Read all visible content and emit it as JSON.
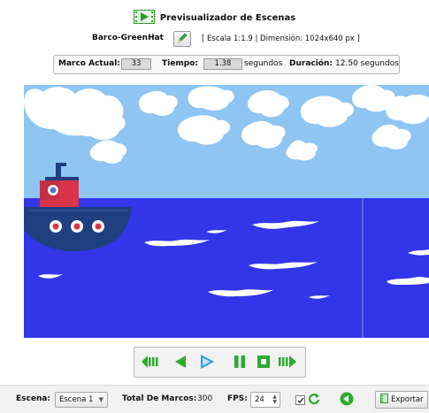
{
  "header": {
    "title": "Previsualizador de Escenas",
    "asset_name": "Barco-GreenHat",
    "scale_info": "[ Escala 1:1.9 | Dimensión: 1024x640 px ]"
  },
  "info": {
    "frame_label": "Marco Actual:",
    "frame_value": "33",
    "time_label": "Tiempo:",
    "time_value": "1.38",
    "time_unit": "segundos",
    "duration_label": "Duración:",
    "duration_value": "12.50 segundos"
  },
  "scene_colors": {
    "sky": "#8ec5f2",
    "sea": "#3236e8",
    "boat_hull": "#1f3f80",
    "cabin": "#d9344a"
  },
  "controls": {
    "icons": [
      "first-frame-icon",
      "step-back-icon",
      "play-icon",
      "pause-icon",
      "stop-icon",
      "last-frame-icon"
    ],
    "accent": "#2eaa2e",
    "play_color": "#2b9cd8"
  },
  "bottom": {
    "scene_label": "Escena:",
    "scene_value": "Escena 1",
    "total_frames_label": "Total De Marcos:",
    "total_frames_value": "300",
    "fps_label": "FPS:",
    "fps_value": "24",
    "export_label": "Exportar"
  }
}
